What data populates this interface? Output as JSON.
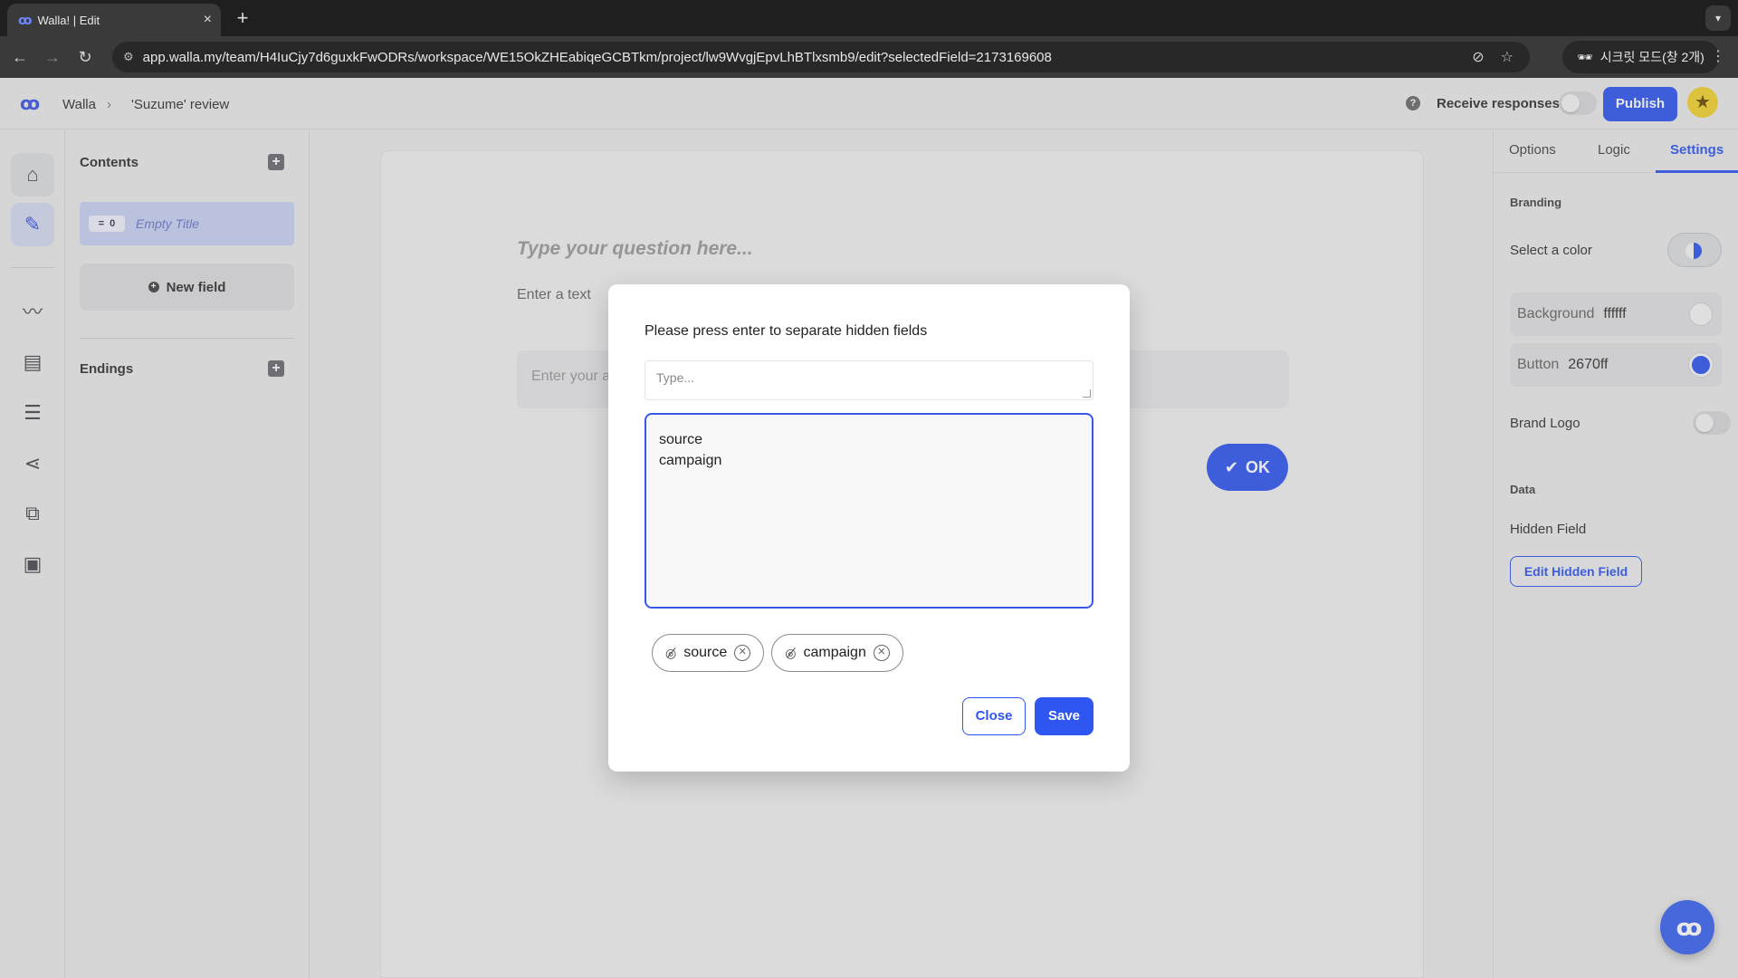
{
  "browser": {
    "tab_title": "Walla! | Edit",
    "url": "app.walla.my/team/H4IuCjy7d6guxkFwODRs/workspace/WE15OkZHEabiqeGCBTkm/project/lw9WvgjEpvLhBTlxsmb9/edit?selectedField=2173169608",
    "incognito_label": "시크릿 모드(창 2개)"
  },
  "header": {
    "breadcrumb_root": "Walla",
    "breadcrumb_sep": "›",
    "breadcrumb_current": "'Suzume' review",
    "receive_responses_label": "Receive responses",
    "publish_label": "Publish"
  },
  "contents_panel": {
    "title": "Contents",
    "field_badge_number": "0",
    "field_title": "Empty Title",
    "new_field_label": "New field",
    "endings_title": "Endings"
  },
  "canvas": {
    "question_placeholder": "Type your question here...",
    "description_placeholder": "Enter a text",
    "answer_placeholder": "Enter your a",
    "ok_label": "OK"
  },
  "settings_panel": {
    "tabs": [
      "Options",
      "Logic",
      "Settings"
    ],
    "active_tab": "Settings",
    "branding_label": "Branding",
    "select_color_label": "Select a color",
    "background_label": "Background",
    "background_value": "ffffff",
    "button_label": "Button",
    "button_value": "2670ff",
    "brand_logo_label": "Brand Logo",
    "data_label": "Data",
    "hidden_field_label": "Hidden Field",
    "edit_hidden_field_label": "Edit Hidden Field"
  },
  "modal": {
    "title": "Please press enter to separate hidden fields",
    "input_placeholder": "Type...",
    "textarea_lines": [
      "source",
      "campaign"
    ],
    "chips": [
      "source",
      "campaign"
    ],
    "close_label": "Close",
    "save_label": "Save"
  },
  "colors": {
    "accent": "#2f56f0",
    "background_swatch": "#ffffff",
    "button_swatch": "#2670ff"
  }
}
